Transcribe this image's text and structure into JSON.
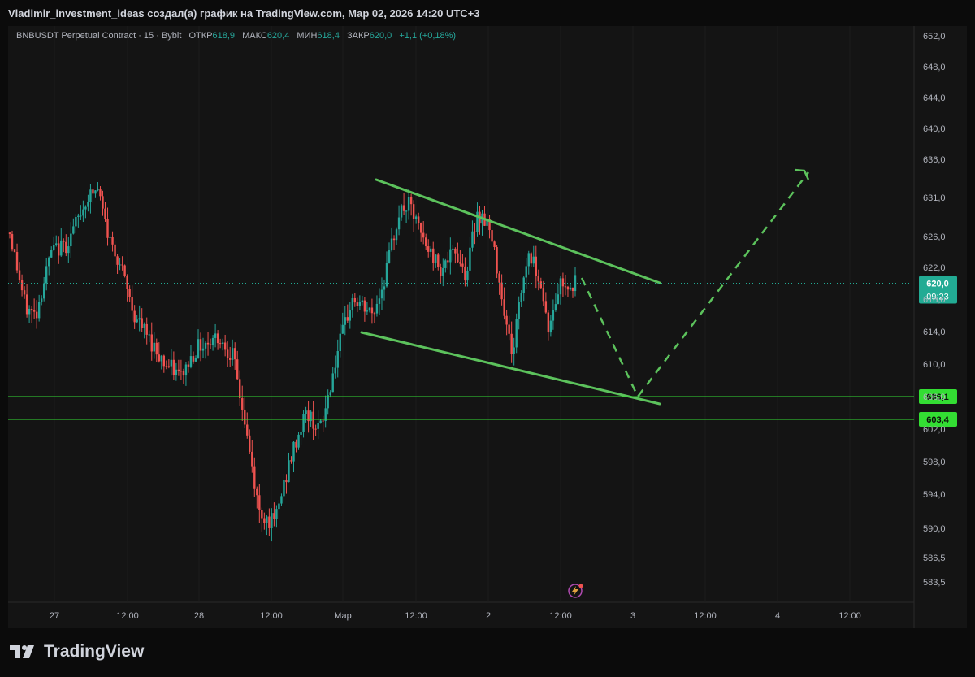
{
  "header": {
    "attribution": "Vladimir_investment_ideas создал(а) график на TradingView.com, Мар 02, 2026 14:20 UTC+3"
  },
  "symbol_info": {
    "symbol": "BNBUSDT Perpetual Contract · 15 · Bybit",
    "open_label": "ОТКР",
    "open_value": "618,9",
    "high_label": "МАКС",
    "high_value": "620,4",
    "low_label": "МИН",
    "low_value": "618,4",
    "close_label": "ЗАКР",
    "close_value": "620,0",
    "change": "+1,1 (+0,18%)"
  },
  "price_axis": {
    "ticks": [
      "652,0",
      "648,0",
      "644,0",
      "640,0",
      "636,0",
      "631,0",
      "626,0",
      "622,0",
      "618,0",
      "614,0",
      "610,0",
      "606,0",
      "602,0",
      "598,0",
      "594,0",
      "590,0",
      "586,5",
      "583,5"
    ],
    "current_price": "620,0",
    "countdown": "09:23",
    "levels": [
      "606,1",
      "603,4"
    ]
  },
  "time_axis": {
    "ticks": [
      "27",
      "12:00",
      "28",
      "12:00",
      "Мар",
      "12:00",
      "2",
      "12:00",
      "3",
      "12:00",
      "4",
      "12:00"
    ]
  },
  "colors": {
    "up": "#26a69a",
    "down": "#ef5350",
    "pattern": "#5cc25c",
    "level": "#33dd33",
    "price_label": "#22ab94"
  },
  "chart_data": {
    "type": "candlestick",
    "symbol": "BNBUSDT",
    "timeframe": "15",
    "exchange": "Bybit",
    "ylim": [
      582,
      654
    ],
    "x_ticks": [
      "27",
      "12:00",
      "28",
      "12:00",
      "Мар",
      "12:00",
      "2",
      "12:00",
      "3",
      "12:00",
      "4",
      "12:00"
    ],
    "close_path": [
      [
        0,
        626.5
      ],
      [
        0.03,
        617
      ],
      [
        0.05,
        616
      ],
      [
        0.08,
        624
      ],
      [
        0.11,
        625
      ],
      [
        0.15,
        631
      ],
      [
        0.17,
        632
      ],
      [
        0.19,
        626
      ],
      [
        0.21,
        623
      ],
      [
        0.24,
        616
      ],
      [
        0.27,
        613
      ],
      [
        0.3,
        610
      ],
      [
        0.33,
        608.5
      ],
      [
        0.36,
        612
      ],
      [
        0.4,
        613.5
      ],
      [
        0.43,
        611
      ],
      [
        0.45,
        604
      ],
      [
        0.48,
        592
      ],
      [
        0.51,
        590.5
      ],
      [
        0.54,
        598
      ],
      [
        0.57,
        604
      ],
      [
        0.6,
        602
      ],
      [
        0.63,
        611
      ],
      [
        0.66,
        618
      ],
      [
        0.7,
        616
      ],
      [
        0.72,
        620
      ],
      [
        0.75,
        629
      ],
      [
        0.77,
        630
      ],
      [
        0.8,
        625
      ],
      [
        0.83,
        622
      ],
      [
        0.86,
        624
      ],
      [
        0.88,
        621
      ],
      [
        0.9,
        629
      ],
      [
        0.92,
        628
      ],
      [
        0.94,
        622
      ],
      [
        0.96,
        614
      ],
      [
        0.97,
        611
      ],
      [
        0.98,
        617
      ],
      [
        1.0,
        624
      ],
      [
        1.02,
        621
      ],
      [
        1.04,
        614
      ],
      [
        1.06,
        620
      ],
      [
        1.09,
        620
      ]
    ],
    "last_price": 620.0,
    "horizontal_levels": [
      606.1,
      603.4
    ],
    "channel_upper": [
      [
        629.4,
        632.7
      ],
      [
        808,
        620.7
      ]
    ],
    "channel_lower": [
      [
        626.4,
        614.6
      ],
      [
        808,
        605.6
      ]
    ],
    "projection": [
      [
        620.2,
        620.5
      ],
      [
        606.5,
        606.9
      ],
      [
        634.8,
        633.0
      ]
    ],
    "annotations": []
  }
}
